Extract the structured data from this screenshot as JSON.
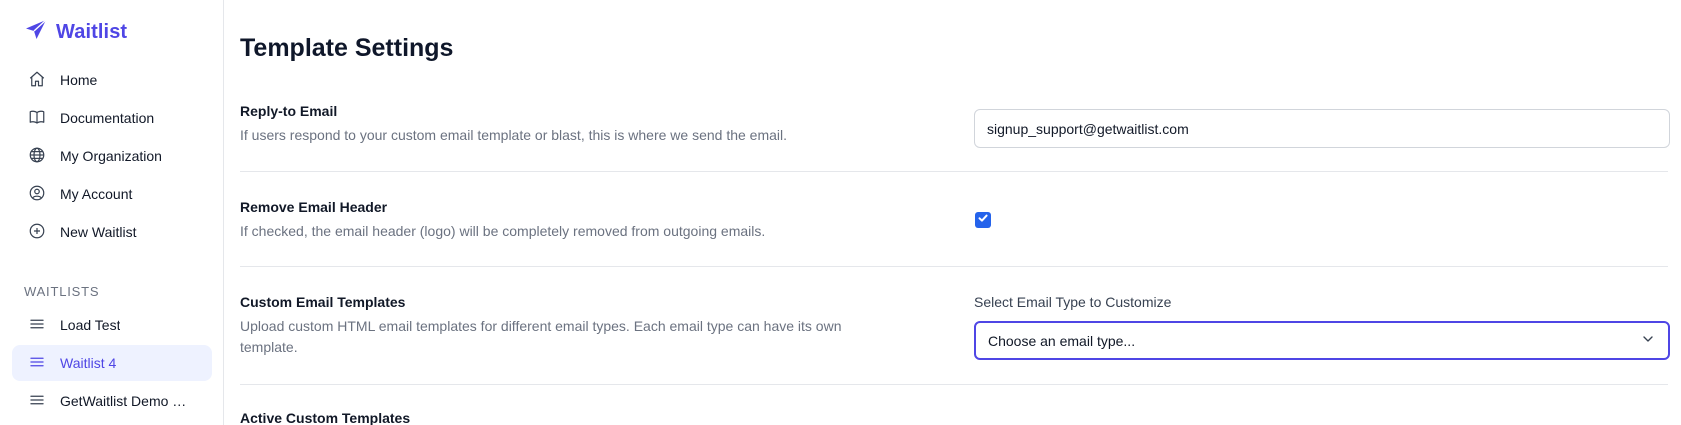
{
  "brand": {
    "name": "Waitlist",
    "accent": "#4f46e5"
  },
  "nav": [
    {
      "label": "Home",
      "icon": "home-icon"
    },
    {
      "label": "Documentation",
      "icon": "book-icon"
    },
    {
      "label": "My Organization",
      "icon": "globe-icon"
    },
    {
      "label": "My Account",
      "icon": "user-circle-icon"
    },
    {
      "label": "New Waitlist",
      "icon": "plus-circle-icon"
    }
  ],
  "waitlists": {
    "title": "WAITLISTS",
    "items": [
      {
        "label": "Load Test",
        "active": false
      },
      {
        "label": "Waitlist 4",
        "active": true
      },
      {
        "label": "GetWaitlist Demo W...",
        "active": false
      }
    ]
  },
  "page": {
    "title": "Template Settings"
  },
  "reply_to": {
    "title": "Reply-to Email",
    "description": "If users respond to your custom email template or blast, this is where we send the email.",
    "value": "signup_support@getwaitlist.com"
  },
  "remove_header": {
    "title": "Remove Email Header",
    "description": "If checked, the email header (logo) will be completely removed from outgoing emails.",
    "checked": true
  },
  "custom_templates": {
    "title": "Custom Email Templates",
    "description": "Upload custom HTML email templates for different email types. Each email type can have its own template.",
    "select_label": "Select Email Type to Customize",
    "select_value": "Choose an email type..."
  },
  "active_templates": {
    "title": "Active Custom Templates"
  },
  "colors": {
    "accent": "#4f46e5",
    "checkbox": "#2563eb",
    "muted": "#6b7280"
  }
}
